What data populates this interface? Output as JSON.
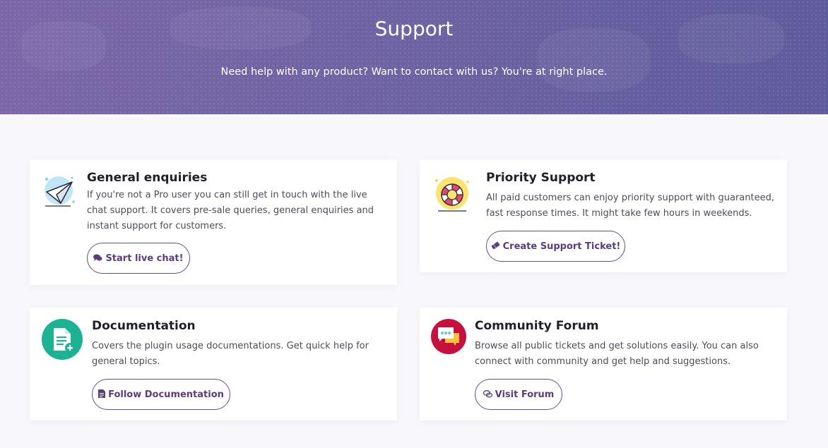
{
  "header": {
    "title": "Support",
    "subtitle": "Need help with any product? Want to contact with us? You're at right place."
  },
  "cards": [
    {
      "title": "General enquiries",
      "description": "If you're not a Pro user you can still get in touch with the live chat support. It covers pre-sale queries, general enquiries and instant support for customers.",
      "button_label": "Start live chat!",
      "icon": "paper-plane-icon",
      "button_icon": "chat-bubbles-icon"
    },
    {
      "title": "Priority Support",
      "description": "All paid customers can enjoy priority support with guaranteed, fast response times. It might take few hours in weekends.",
      "button_label": "Create Support Ticket!",
      "icon": "lifebuoy-icon",
      "button_icon": "ticket-icon"
    },
    {
      "title": "Documentation",
      "description": "Covers the plugin usage documentations. Get quick help for general topics.",
      "button_label": "Follow Documentation",
      "icon": "document-add-icon",
      "button_icon": "file-text-icon"
    },
    {
      "title": "Community Forum",
      "description": "Browse all public tickets and get solutions easily. You can also connect with community and get help and suggestions.",
      "button_label": "Visit Forum",
      "icon": "forum-chat-icon",
      "button_icon": "comments-icon"
    }
  ],
  "colors": {
    "header_start": "#7b68a8",
    "header_end": "#5f5c9c",
    "button_border": "#6a4b8c",
    "button_text": "#5a3d7e",
    "documentation_icon_bg": "#1cb394",
    "forum_icon_bg": "#c8103f"
  }
}
